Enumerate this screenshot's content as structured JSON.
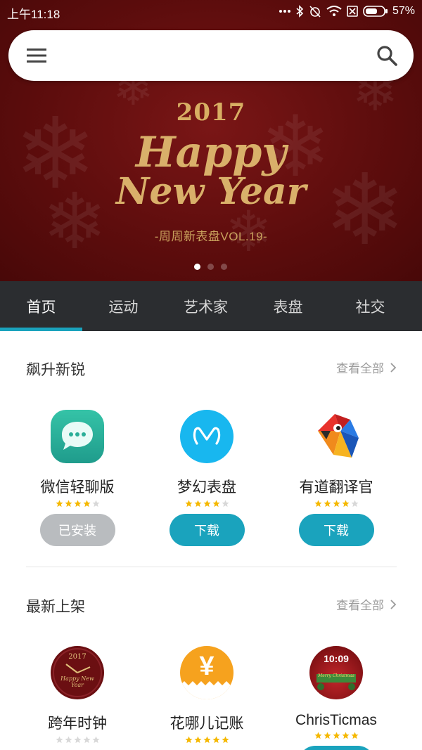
{
  "status_bar": {
    "time": "上午11:18",
    "battery": "57%"
  },
  "search": {
    "placeholder": ""
  },
  "banner": {
    "year": "2017",
    "happy": "Happy",
    "new_year": "New Year",
    "subtitle": "-周周新表盘VOL.19-",
    "page_count": 3,
    "active_page": 0
  },
  "tabs": [
    {
      "label": "首页",
      "active": true
    },
    {
      "label": "运动",
      "active": false
    },
    {
      "label": "艺术家",
      "active": false
    },
    {
      "label": "表盘",
      "active": false
    },
    {
      "label": "社交",
      "active": false
    }
  ],
  "sections": [
    {
      "title": "飙升新锐",
      "see_all": "查看全部",
      "apps": [
        {
          "name": "微信轻聊版",
          "icon": "wechat-chat-icon",
          "rating": 4,
          "button": "已安装",
          "installed": true
        },
        {
          "name": "梦幻表盘",
          "icon": "dream-watchface-icon",
          "rating": 4,
          "button": "下载",
          "installed": false
        },
        {
          "name": "有道翻译官",
          "icon": "youdao-bird-icon",
          "rating": 4,
          "button": "下载",
          "installed": false
        }
      ]
    },
    {
      "title": "最新上架",
      "see_all": "查看全部",
      "apps": [
        {
          "name": "跨年时钟",
          "icon": "newyear-clock-icon",
          "rating": 0,
          "clock_year": "2017",
          "clock_text": "Happy New Year"
        },
        {
          "name": "花哪儿记账",
          "icon": "yuan-ledger-icon",
          "rating": 5,
          "symbol": "¥"
        },
        {
          "name": "ChrisTicmas",
          "icon": "christmas-watch-icon",
          "rating": 5,
          "time_text": "10:09",
          "banner_text": "Merry Christmas"
        }
      ]
    }
  ],
  "colors": {
    "accent": "#1aa3bd",
    "banner_red": "#5e0d0d",
    "tabbar": "#2b2d30",
    "star_gold": "#f5b800",
    "installed_gray": "#b9bcbf"
  }
}
